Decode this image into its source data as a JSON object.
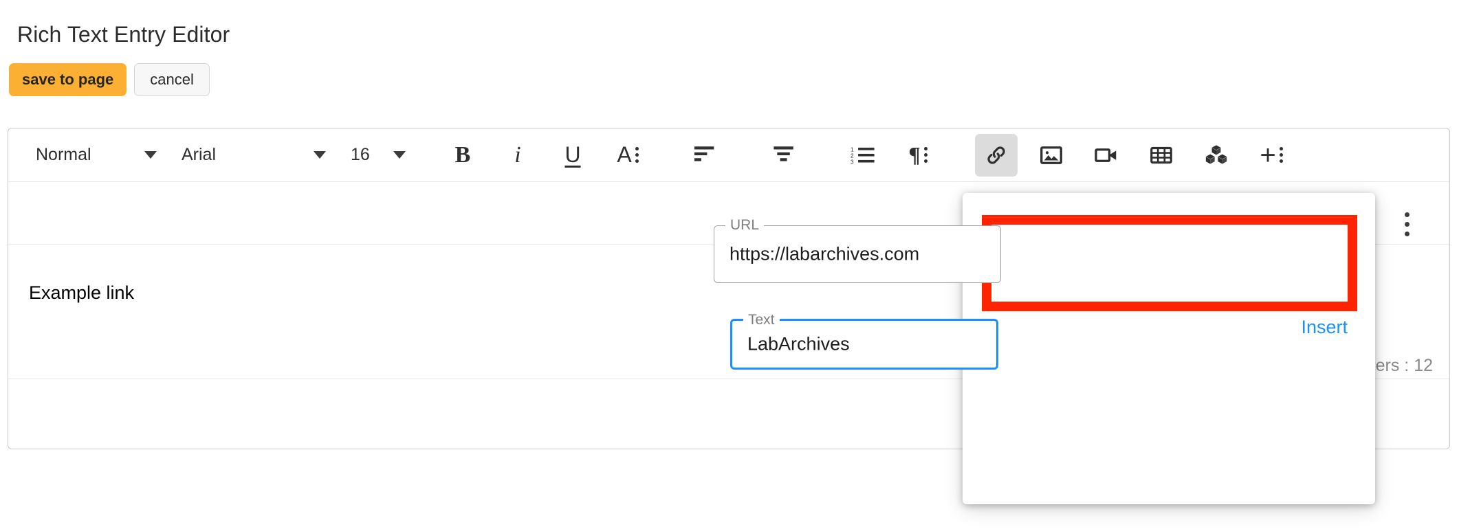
{
  "header": {
    "title": "Rich Text Entry Editor",
    "save_label": "save to page",
    "cancel_label": "cancel"
  },
  "toolbar": {
    "block_format": "Normal",
    "font_family": "Arial",
    "font_size": "16",
    "bold": "B",
    "italic": "i",
    "underline": "U",
    "text_style": "A",
    "paragraph": "¶",
    "plus": "+"
  },
  "editor": {
    "content_text": "Example link",
    "char_count": "ers : 12"
  },
  "link_popup": {
    "url_label": "URL",
    "url_value": "https://labarchives.com",
    "url_placeholder": "URL",
    "text_label": "Text",
    "text_value": "LabArchives",
    "text_placeholder": "Text",
    "insert_label": "Insert"
  },
  "colors": {
    "accent_save": "#FBB034",
    "annotation_red": "#FF2400",
    "focus_blue": "#1A90FF",
    "link_blue": "#1A90FF"
  }
}
